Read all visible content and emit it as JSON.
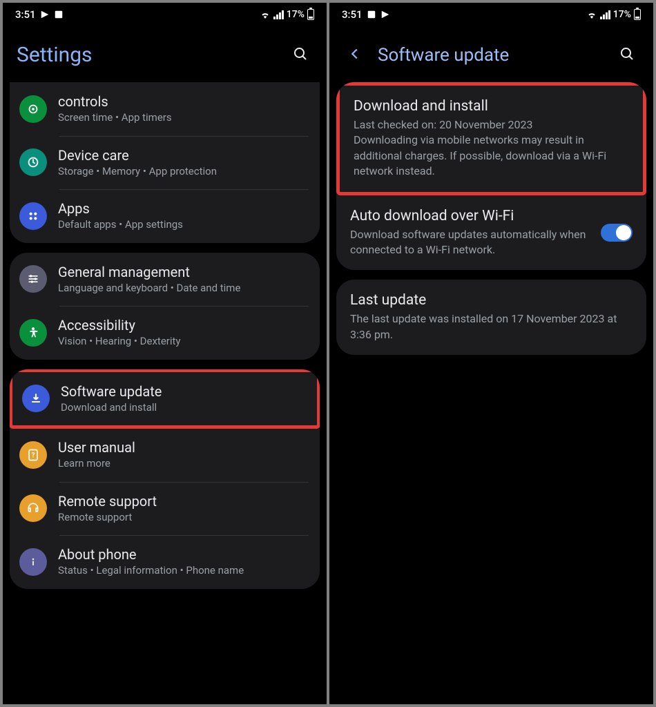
{
  "statusbar": {
    "time": "3:51",
    "battery_pct": "17%"
  },
  "left": {
    "title": "Settings",
    "items": [
      {
        "icon": "controls",
        "iconColor": "#0a8f3c",
        "title": "controls",
        "sub": "Screen time  •  App timers"
      },
      {
        "icon": "device-care",
        "iconColor": "#0a8f7c",
        "title": "Device care",
        "sub": "Storage  •  Memory  •  App protection"
      },
      {
        "icon": "apps",
        "iconColor": "#3b5bdb",
        "title": "Apps",
        "sub": "Default apps  •  App settings"
      },
      {
        "icon": "general",
        "iconColor": "#5c5c70",
        "title": "General management",
        "sub": "Language and keyboard  •  Date and time"
      },
      {
        "icon": "accessibility",
        "iconColor": "#0a8f3c",
        "title": "Accessibility",
        "sub": "Vision  •  Hearing  •  Dexterity"
      },
      {
        "icon": "software-update",
        "iconColor": "#3b5bdb",
        "title": "Software update",
        "sub": "Download and install"
      },
      {
        "icon": "user-manual",
        "iconColor": "#e8a02c",
        "title": "User manual",
        "sub": "Learn more"
      },
      {
        "icon": "remote-support",
        "iconColor": "#e8a02c",
        "title": "Remote support",
        "sub": "Remote support"
      },
      {
        "icon": "about",
        "iconColor": "#5c5c9c",
        "title": "About phone",
        "sub": "Status  •  Legal information  •  Phone name"
      }
    ]
  },
  "right": {
    "title": "Software update",
    "download": {
      "title": "Download and install",
      "line1": "Last checked on: 20 November 2023",
      "line2": "Downloading via mobile networks may result in additional charges. If possible, download via a Wi-Fi network instead."
    },
    "auto": {
      "title": "Auto download over Wi-Fi",
      "sub": "Download software updates automatically when connected to a Wi-Fi network.",
      "toggled": true
    },
    "last": {
      "title": "Last update",
      "sub": "The last update was installed on 17 November 2023 at 3:36 pm."
    }
  }
}
